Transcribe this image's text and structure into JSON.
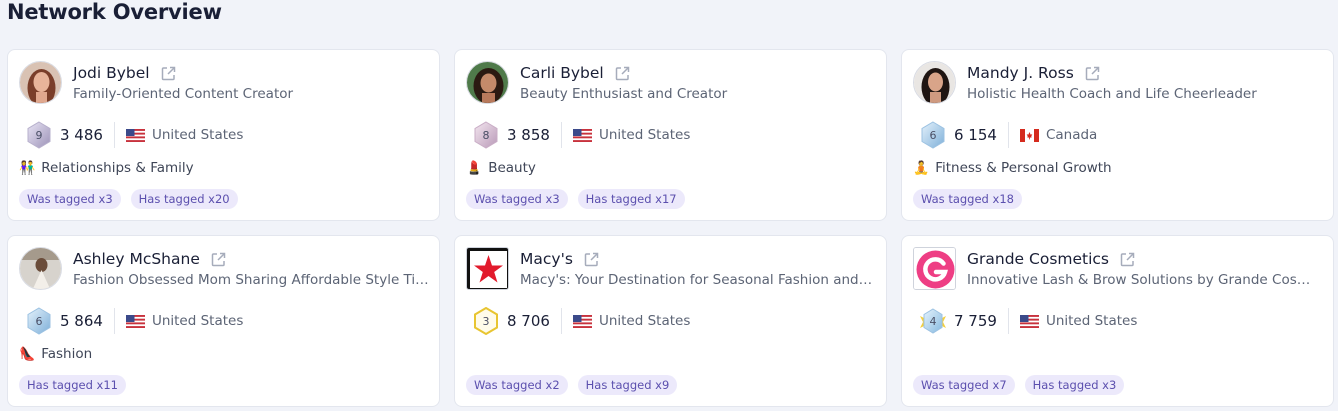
{
  "page": {
    "title": "Network Overview"
  },
  "colors": {
    "tag_bg": "#ece9fb",
    "tag_text": "#5b4fae",
    "page_bg": "#f1f3f9"
  },
  "cards": [
    {
      "name": "Jodi Bybel",
      "subtitle": "Family-Oriented Content Creator",
      "level": "9",
      "followers": "3 486",
      "country": "United States",
      "flag": "us-flag-icon",
      "category_icon": "👫",
      "category": "Relationships & Family",
      "tags": [
        "Was tagged x3",
        "Has tagged x20"
      ]
    },
    {
      "name": "Carli Bybel",
      "subtitle": "Beauty Enthusiast and Creator",
      "level": "8",
      "followers": "3 858",
      "country": "United States",
      "flag": "us-flag-icon",
      "category_icon": "💄",
      "category": "Beauty",
      "tags": [
        "Was tagged x3",
        "Has tagged x17"
      ]
    },
    {
      "name": "Mandy J. Ross",
      "subtitle": "Holistic Health Coach and Life Cheerleader",
      "level": "6",
      "followers": "6 154",
      "country": "Canada",
      "flag": "ca-flag-icon",
      "category_icon": "🧘",
      "category": "Fitness & Personal Growth",
      "tags": [
        "Was tagged x18"
      ]
    },
    {
      "name": "Ashley McShane",
      "subtitle": "Fashion Obsessed Mom Sharing Affordable Style Tips",
      "level": "6",
      "followers": "5 864",
      "country": "United States",
      "flag": "us-flag-icon",
      "category_icon": "👠",
      "category": "Fashion",
      "tags": [
        "Has tagged x11"
      ]
    },
    {
      "name": "Macy's",
      "subtitle": "Macy's: Your Destination for Seasonal Fashion and Home",
      "level": "3",
      "followers": "8 706",
      "country": "United States",
      "flag": "us-flag-icon",
      "category_icon": "",
      "category": "",
      "tags": [
        "Was tagged x2",
        "Has tagged x9"
      ]
    },
    {
      "name": "Grande Cosmetics",
      "subtitle": "Innovative Lash & Brow Solutions by Grande Cosmetics",
      "level": "4",
      "followers": "7 759",
      "country": "United States",
      "flag": "us-flag-icon",
      "category_icon": "",
      "category": "",
      "tags": [
        "Was tagged x7",
        "Has tagged x3"
      ]
    }
  ]
}
